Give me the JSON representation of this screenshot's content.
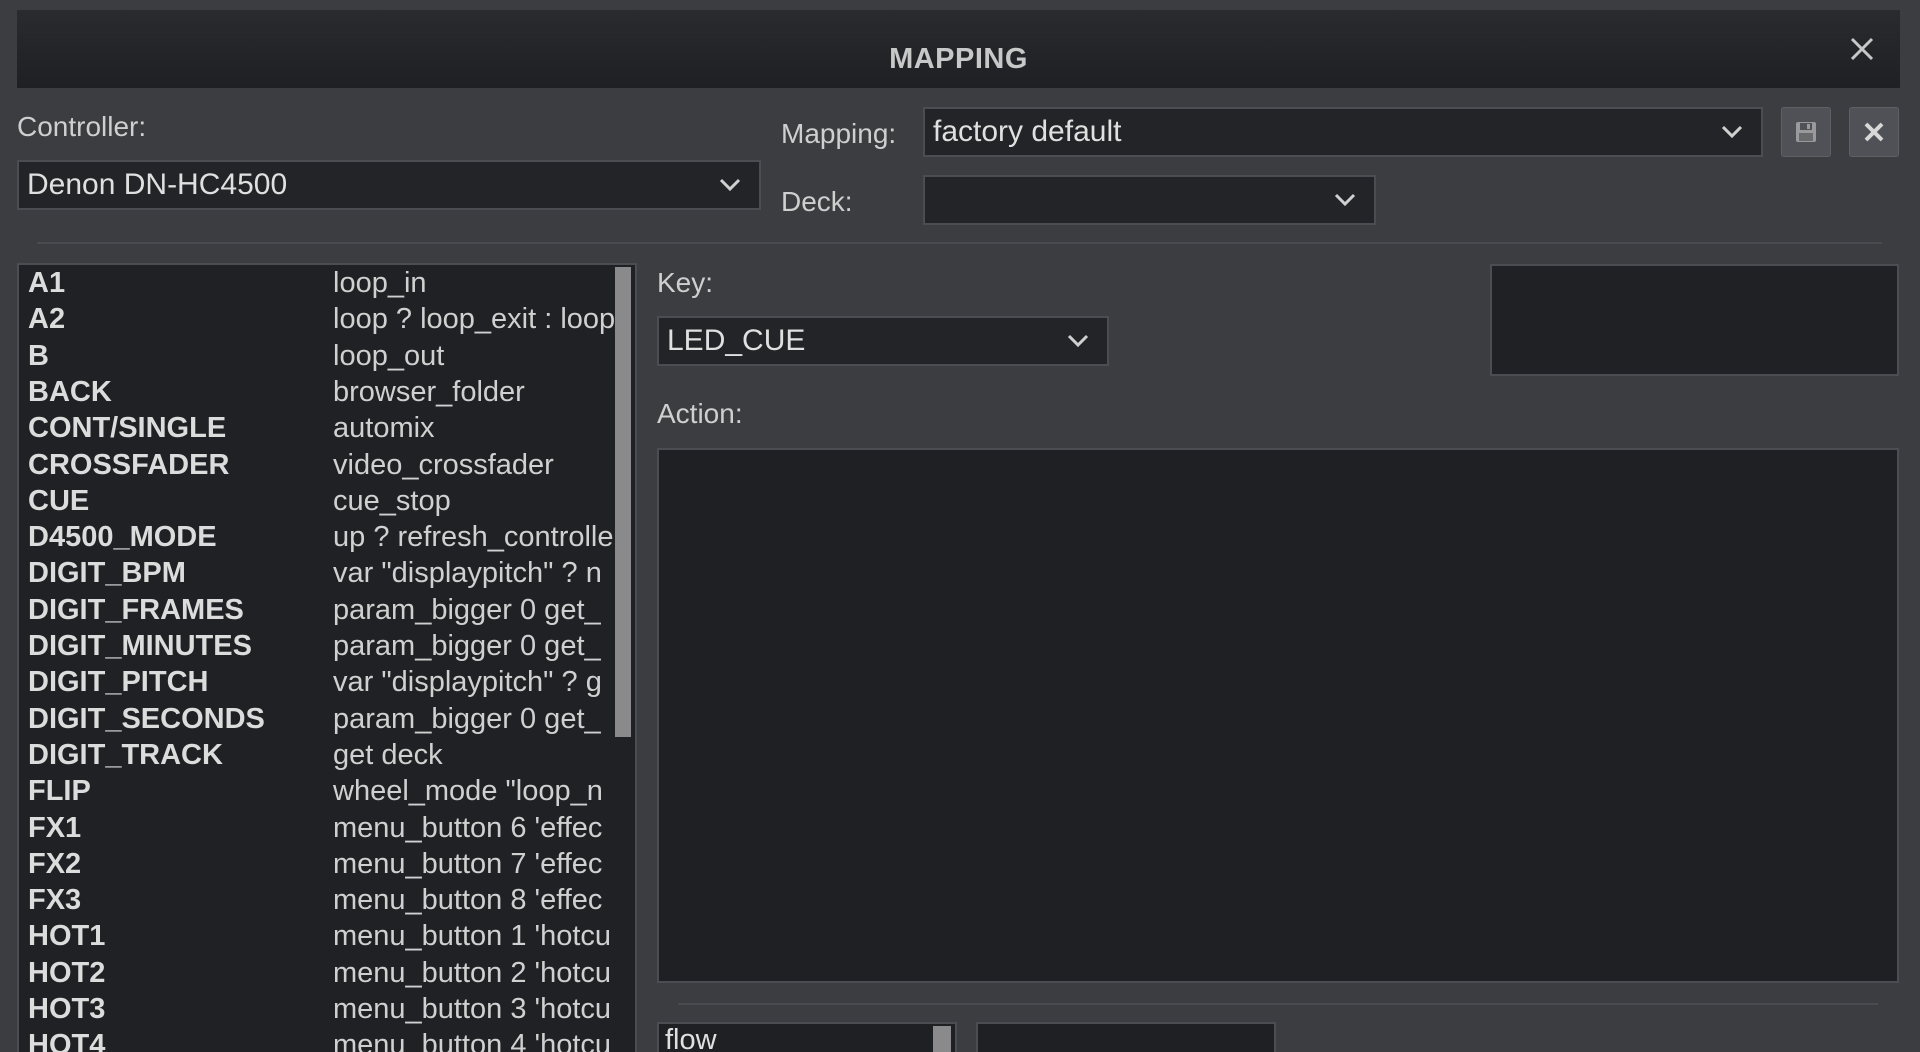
{
  "window": {
    "title": "MAPPING"
  },
  "controller": {
    "label": "Controller:",
    "value": "Denon DN-HC4500"
  },
  "mapping": {
    "label": "Mapping:",
    "value": "factory default"
  },
  "deck": {
    "label": "Deck:",
    "value": ""
  },
  "key": {
    "label": "Key:",
    "value": "LED_CUE"
  },
  "action": {
    "label": "Action:",
    "value": ""
  },
  "bottom": {
    "field1": "flow",
    "field2": ""
  },
  "keys": [
    {
      "key": "A1",
      "action": "loop_in"
    },
    {
      "key": "A2",
      "action": "loop ? loop_exit : loop"
    },
    {
      "key": "B",
      "action": "loop_out"
    },
    {
      "key": "BACK",
      "action": "browser_folder"
    },
    {
      "key": "CONT/SINGLE",
      "action": "automix"
    },
    {
      "key": "CROSSFADER",
      "action": "video_crossfader"
    },
    {
      "key": "CUE",
      "action": "cue_stop"
    },
    {
      "key": "D4500_MODE",
      "action": "up ? refresh_controller"
    },
    {
      "key": "DIGIT_BPM",
      "action": "var \"displaypitch\" ? n"
    },
    {
      "key": "DIGIT_FRAMES",
      "action": "param_bigger 0 get_"
    },
    {
      "key": "DIGIT_MINUTES",
      "action": "param_bigger 0 get_"
    },
    {
      "key": "DIGIT_PITCH",
      "action": "var \"displaypitch\" ? g"
    },
    {
      "key": "DIGIT_SECONDS",
      "action": "param_bigger 0 get_"
    },
    {
      "key": "DIGIT_TRACK",
      "action": "get deck"
    },
    {
      "key": "FLIP",
      "action": "wheel_mode \"loop_n"
    },
    {
      "key": "FX1",
      "action": "menu_button 6 'effec"
    },
    {
      "key": "FX2",
      "action": "menu_button 7 'effec"
    },
    {
      "key": "FX3",
      "action": "menu_button 8 'effec"
    },
    {
      "key": "HOT1",
      "action": "menu_button 1 'hotcu"
    },
    {
      "key": "HOT2",
      "action": "menu_button 2 'hotcu"
    },
    {
      "key": "HOT3",
      "action": "menu_button 3 'hotcu"
    },
    {
      "key": "HOT4",
      "action": "menu_button 4 'hotcu"
    }
  ],
  "icons": {
    "close": "close-icon",
    "save": "save-icon",
    "delete": "delete-icon",
    "chevron": "chevron-down-icon"
  },
  "colors": {
    "background": "#3c3d41",
    "field": "#232427",
    "border": "#4c4d52"
  }
}
